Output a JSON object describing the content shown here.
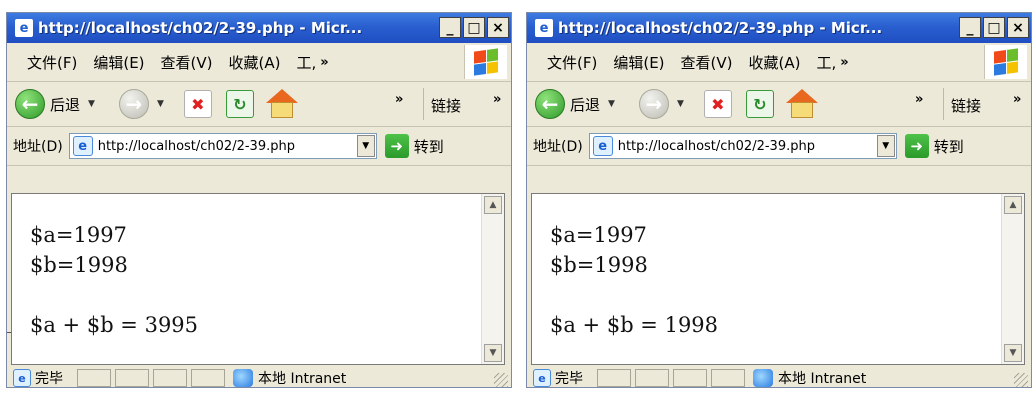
{
  "windows": [
    {
      "title": "http://localhost/ch02/2-39.php - Micr...",
      "menu": [
        "文件(F)",
        "编辑(E)",
        "查看(V)",
        "收藏(A)",
        "工,"
      ],
      "toolbar": {
        "back_label": "后退",
        "links_label": "链接"
      },
      "address": {
        "label": "地址(D)",
        "url": "http://localhost/ch02/2-39.php",
        "go_label": "转到"
      },
      "output": [
        "$a=1997",
        "$b=1998",
        "$a + $b = 3995"
      ],
      "status": {
        "text": "完毕",
        "zone": "本地 Intranet"
      }
    },
    {
      "title": "http://localhost/ch02/2-39.php - Micr...",
      "menu": [
        "文件(F)",
        "编辑(E)",
        "查看(V)",
        "收藏(A)",
        "工,"
      ],
      "toolbar": {
        "back_label": "后退",
        "links_label": "链接"
      },
      "address": {
        "label": "地址(D)",
        "url": "http://localhost/ch02/2-39.php",
        "go_label": "转到"
      },
      "output": [
        "$a=1997",
        "$b=1998",
        "$a + $b = 1998"
      ],
      "status": {
        "text": "完毕",
        "zone": "本地 Intranet"
      }
    }
  ],
  "icons": {
    "title": "ie-page-icon",
    "back": "back-arrow-icon",
    "forward": "forward-arrow-icon",
    "stop": "stop-icon",
    "refresh": "refresh-icon",
    "home": "home-icon",
    "go": "go-arrow-icon",
    "zone": "intranet-zone-icon"
  },
  "colors": {
    "titlebar": "#2a5fd0",
    "chrome": "#ece9d8"
  }
}
